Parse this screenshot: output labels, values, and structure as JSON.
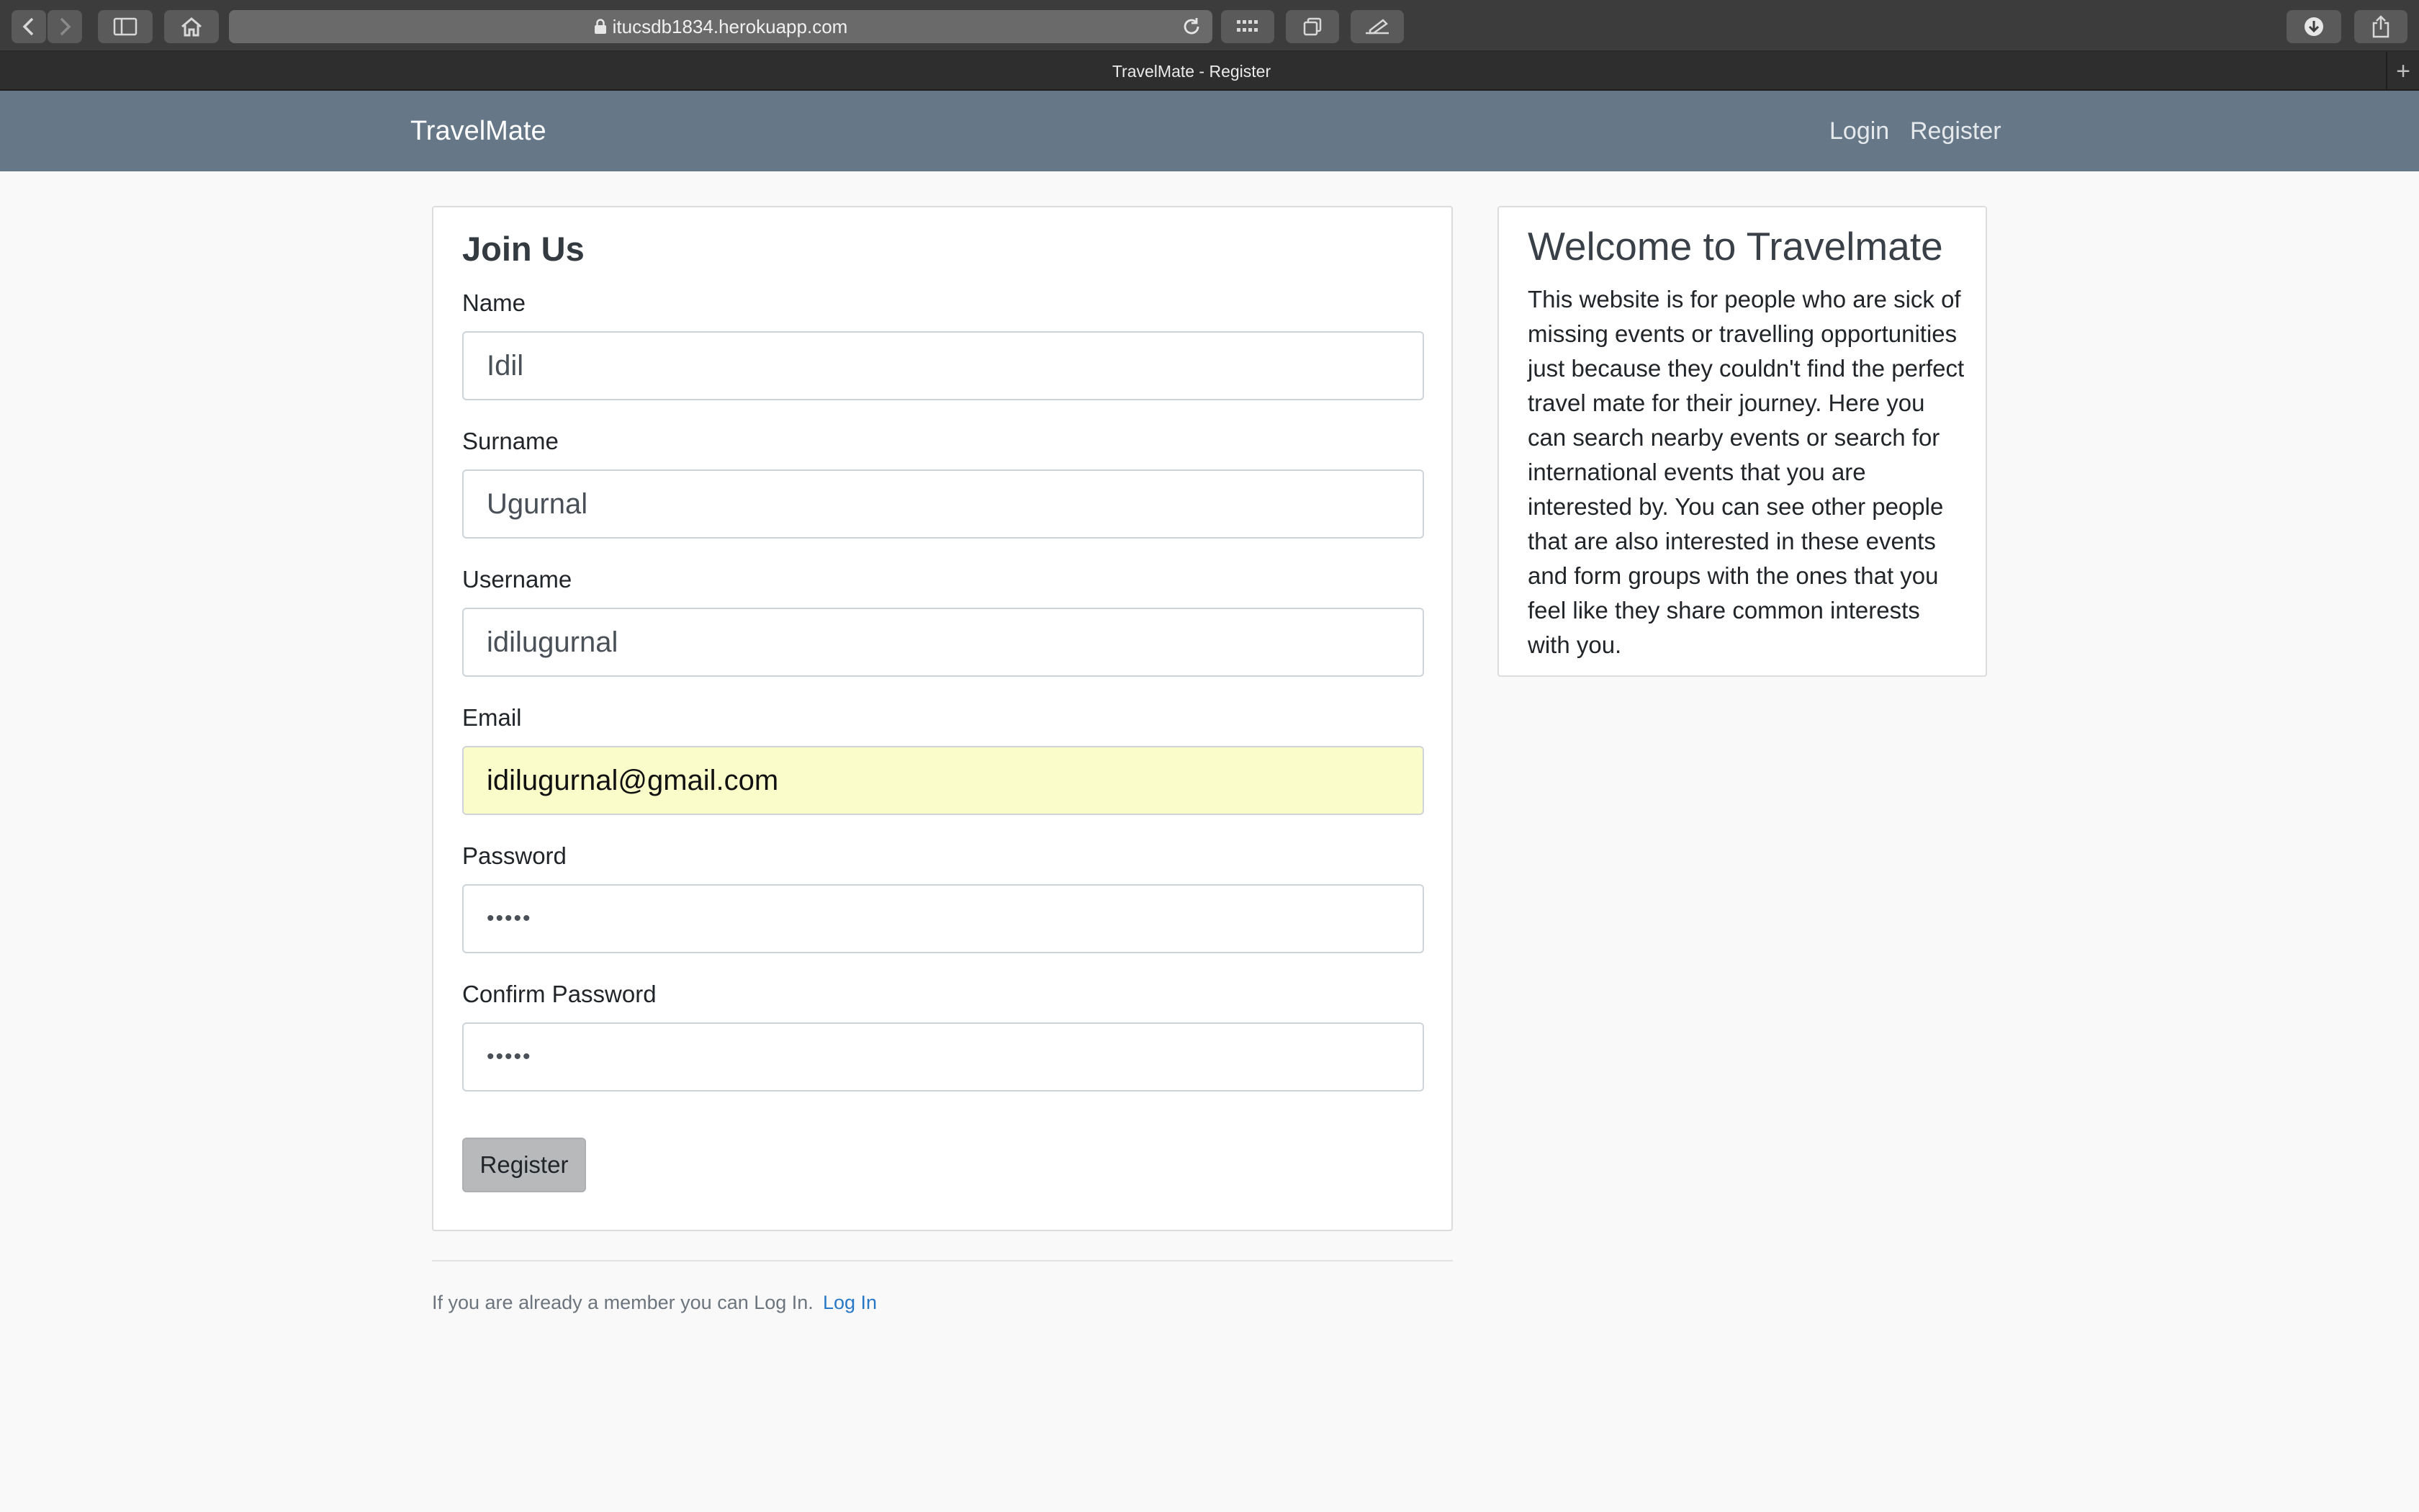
{
  "browser": {
    "url": "itucsdb1834.herokuapp.com",
    "tab_title": "TravelMate - Register",
    "new_tab_glyph": "+",
    "icons": [
      "back-icon",
      "forward-icon",
      "sidebar-icon",
      "home-icon",
      "lock-icon",
      "reload-icon",
      "grid-icon",
      "tabs-icon",
      "edit-icon",
      "download-icon",
      "share-icon"
    ]
  },
  "navbar": {
    "brand": "TravelMate",
    "links": {
      "login": "Login",
      "register": "Register"
    },
    "color": "#667788"
  },
  "register_form": {
    "title": "Join Us",
    "fields": {
      "name": {
        "label": "Name",
        "value": "Idil"
      },
      "surname": {
        "label": "Surname",
        "value": "Ugurnal"
      },
      "username": {
        "label": "Username",
        "value": "idilugurnal"
      },
      "email": {
        "label": "Email",
        "value": "idilugurnal@gmail.com"
      },
      "password": {
        "label": "Password",
        "value": "•••••"
      },
      "confirm_password": {
        "label": "Confirm Password",
        "value": "•••••"
      }
    },
    "submit_label": "Register",
    "autofill_color": "#fafdc9"
  },
  "footer": {
    "text": "If you are already a member you can Log In.",
    "link": "Log In",
    "link_color": "#2878c8"
  },
  "welcome": {
    "title": "Welcome to Travelmate",
    "body": "This website is for people who are sick of missing events or travelling opportunities just because they couldn't find the perfect travel mate for their journey. Here you can search nearby events or search for international events that you are interested by. You can see other people that are also interested in these events and form groups with the ones that you feel like they share common interests with you."
  }
}
